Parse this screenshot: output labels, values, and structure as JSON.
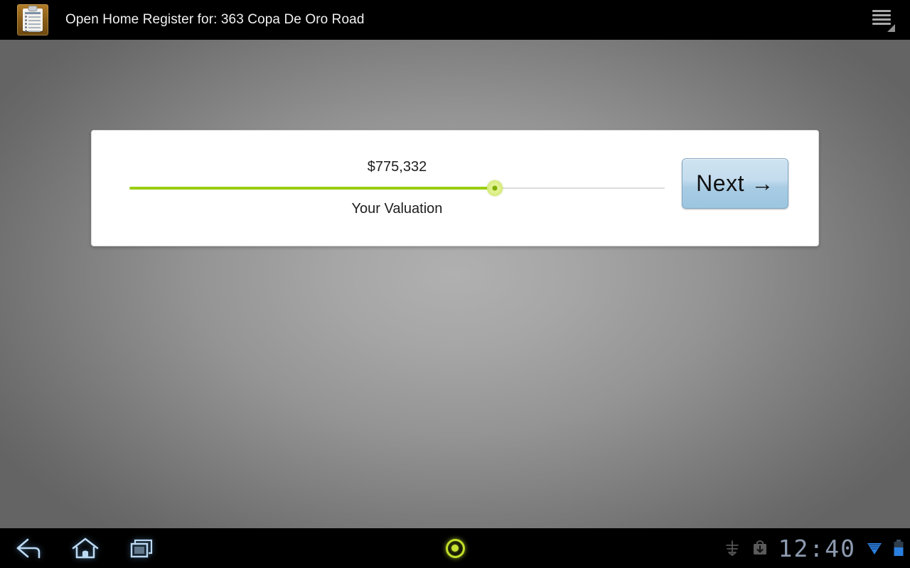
{
  "window": {
    "title": "Open Home Register for: 363 Copa De Oro Road",
    "app_icon": "clipboard-icon",
    "overflow_menu": "overflow-menu-icon"
  },
  "card": {
    "slider": {
      "value_label": "$775,332",
      "caption": "Your Valuation",
      "fill_percent": 68.2,
      "fill_color": "#9acd11",
      "track_color": "#dcdcdc",
      "thumb_color": "#dff07a",
      "thumb_dot_color": "#7fae09"
    },
    "next_button": {
      "label": "Next →",
      "accent_color": "#a9cce4"
    }
  },
  "system_bar": {
    "back": "back-icon",
    "home": "home-icon",
    "recents": "recents-icon",
    "record_indicator": "record-indicator-icon",
    "status": {
      "usb_debug": "usb-debug-icon",
      "download": "download-icon",
      "clock": "12:40",
      "wifi": "wifi-icon",
      "battery": "battery-icon"
    }
  },
  "theme": {
    "action_bar_bg": "#000000",
    "background_center": "#b0b0b0",
    "background_edge": "#646464",
    "card_bg": "#ffffff",
    "title_color": "#f2f2f2",
    "clock_color": "#8d9bb0"
  }
}
